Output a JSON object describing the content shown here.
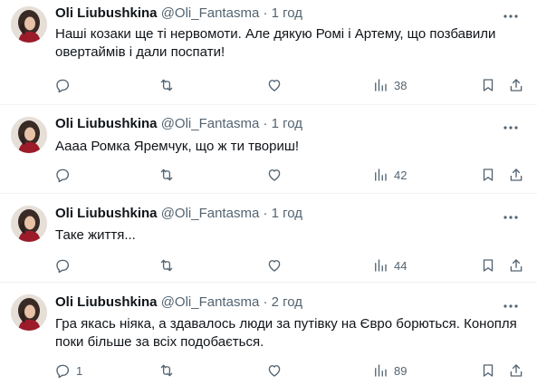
{
  "tweets": [
    {
      "name": "Oli Liubushkina",
      "handle": "@Oli_Fantasma",
      "dot": "·",
      "time": "1 год",
      "text": "Наші козаки ще ті нервомоти. Але дякую Ромі і Артему, що позбавили овертаймів і дали поспати!",
      "replies": "",
      "views": "38"
    },
    {
      "name": "Oli Liubushkina",
      "handle": "@Oli_Fantasma",
      "dot": "·",
      "time": "1 год",
      "text": "Аааа Ромка Яремчук, що ж ти твориш!",
      "replies": "",
      "views": "42"
    },
    {
      "name": "Oli Liubushkina",
      "handle": "@Oli_Fantasma",
      "dot": "·",
      "time": "1 год",
      "text": "Таке життя...",
      "replies": "",
      "views": "44"
    },
    {
      "name": "Oli Liubushkina",
      "handle": "@Oli_Fantasma",
      "dot": "·",
      "time": "2 год",
      "text": "Гра якась ніяка, а здавалось люди за путівку на Євро борються. Конопля поки більше за всіх подобається.",
      "replies": "1",
      "views": "89"
    }
  ],
  "icons": {
    "reply": "reply-icon",
    "retweet": "retweet-icon",
    "like": "heart-icon",
    "views": "views-icon",
    "bookmark": "bookmark-icon",
    "share": "share-icon",
    "more": "more-icon"
  },
  "colors": {
    "text": "#0f1419",
    "secondary": "#536471",
    "divider": "#eff3f4"
  }
}
